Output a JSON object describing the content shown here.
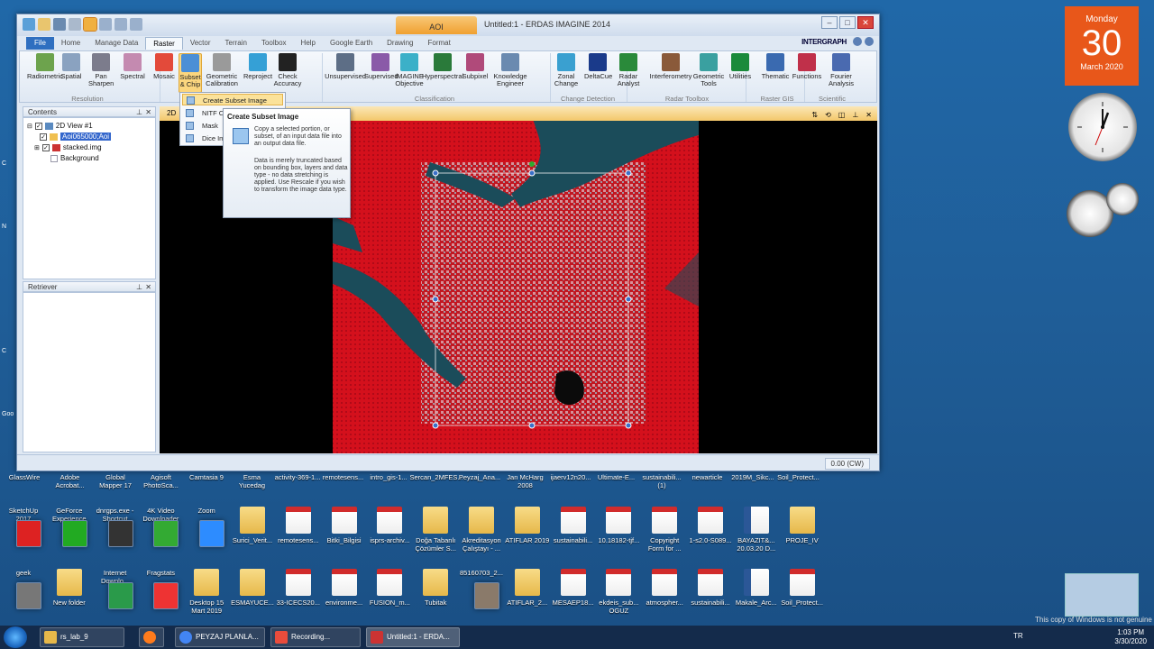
{
  "app": {
    "title": "Untitled:1 - ERDAS IMAGINE 2014",
    "contextual_tab": "AOI",
    "brand": "INTERGRAPH",
    "tabs": [
      "File",
      "Home",
      "Manage Data",
      "Raster",
      "Vector",
      "Terrain",
      "Toolbox",
      "Help",
      "Google Earth",
      "Drawing",
      "Format"
    ],
    "active_tab": "Raster",
    "ribbon": {
      "buttons": [
        {
          "label": "Radiometric",
          "color": "#6da34d"
        },
        {
          "label": "Spatial",
          "color": "#8aa2c0"
        },
        {
          "label": "Pan\nSharpen",
          "color": "#7c7c8c"
        },
        {
          "label": "Spectral",
          "color": "#c48ab0"
        },
        {
          "label": "Mosaic",
          "color": "#e34a3a"
        },
        {
          "label": "Subset\n& Chip",
          "color": "#4b8fd6"
        },
        {
          "label": "Geometric\nCalibration",
          "color": "#9a9a9a"
        },
        {
          "label": "Reproject",
          "color": "#35a0d6"
        },
        {
          "label": "Check\nAccuracy",
          "color": "#222222"
        },
        {
          "label": "Unsupervised",
          "color": "#5d6e86"
        },
        {
          "label": "Supervised",
          "color": "#8a5aa8"
        },
        {
          "label": "IMAGINE\nObjective",
          "color": "#3bb0c8"
        },
        {
          "label": "Hyperspectral",
          "color": "#2a7a3a"
        },
        {
          "label": "Subpixel",
          "color": "#b04a7a"
        },
        {
          "label": "Knowledge\nEngineer",
          "color": "#6a8ab0"
        },
        {
          "label": "Zonal\nChange",
          "color": "#3aa0d0"
        },
        {
          "label": "DeltaCue",
          "color": "#1a3a8a"
        },
        {
          "label": "Radar\nAnalyst",
          "color": "#2a8a3a"
        },
        {
          "label": "Interferometry",
          "color": "#8a5a3a"
        },
        {
          "label": "Geometric\nTools",
          "color": "#3aa0a0"
        },
        {
          "label": "Utilities",
          "color": "#1a8a3a"
        },
        {
          "label": "Thematic",
          "color": "#3a6ab0"
        },
        {
          "label": "Functions",
          "color": "#c0304a"
        },
        {
          "label": "Fourier\nAnalysis",
          "color": "#4a6ab0"
        }
      ],
      "groups": [
        "Resolution",
        "Classification",
        "Change Detection",
        "Radar Toolbox",
        "Raster GIS",
        "Scientific"
      ]
    },
    "contents_panel": {
      "title": "Contents",
      "items": [
        {
          "label": "2D View #1",
          "checked": true
        },
        {
          "label": "Aoi065000;Aoi",
          "checked": true
        },
        {
          "label": "stacked.img",
          "checked": true
        },
        {
          "label": "Background",
          "checked": false
        }
      ]
    },
    "retriever_panel": {
      "title": "Retriever"
    },
    "view": {
      "title_prefix": "2D"
    },
    "status": {
      "coord": "0.00 (CW)"
    },
    "subset_menu": {
      "items": [
        "Create Subset Image",
        "NITF C...",
        "Mask",
        "Dice Im..."
      ],
      "selected": "Create Subset Image"
    },
    "tooltip": {
      "title": "Create Subset Image",
      "p1": "Copy a selected portion, or subset, of an input data file into an output data file.",
      "p2": "Data is merely truncated based on bounding box, layers and data type - no data stretching is applied. Use Rescale if you wish to transform the image data type."
    }
  },
  "clock_tile": {
    "dow": "Monday",
    "day": "30",
    "month_year": "March 2020"
  },
  "desktop": {
    "top_labels": [
      "GlassWire",
      "Adobe\nAcrobat...",
      "Global\nMapper 17",
      "Agisoft\nPhotoSca...",
      "Camtasia 9",
      "Esma\nYucedag",
      "activity-369-1...",
      "remotesens...",
      "intro_gis-1...",
      "Sercan_2MFES...",
      "Peyzaj_Ana...",
      "Jan McHarg\n2008",
      "ijaerv12n20...",
      "Ultimate-E...",
      "sustainabili...\n(1)",
      "newarticle",
      "2019M_Sikc...",
      "Soil_Protect..."
    ],
    "row1": [
      {
        "label": "SketchUp\n2017",
        "type": "app",
        "color": "#d22"
      },
      {
        "label": "GeForce\nExperience",
        "type": "app",
        "color": "#2a2"
      },
      {
        "label": "dnrgps.exe -\nShortcut",
        "type": "app",
        "color": "#333"
      },
      {
        "label": "4K Video\nDownloader",
        "type": "app",
        "color": "#3a3"
      },
      {
        "label": "Zoom",
        "type": "app",
        "color": "#2d8cff"
      },
      {
        "label": "Surici_Verit...",
        "type": "folder"
      },
      {
        "label": "remotesens...",
        "type": "pdf"
      },
      {
        "label": "Bitki_Bilgisi",
        "type": "pdf"
      },
      {
        "label": "isprs-archiv...",
        "type": "pdf"
      },
      {
        "label": "Doğa Tabanlı\nÇözümler S...",
        "type": "folder"
      },
      {
        "label": "Akreditasyon\nÇalıştayı - ...",
        "type": "folder"
      },
      {
        "label": "ATIFLAR 2019",
        "type": "folder"
      },
      {
        "label": "sustainabili...",
        "type": "pdf"
      },
      {
        "label": "10.18182-tjf...",
        "type": "pdf"
      },
      {
        "label": "Copyright\nForm for ...",
        "type": "pdf"
      },
      {
        "label": "1-s2.0-S089...",
        "type": "pdf"
      },
      {
        "label": "BAYAZIT&...\n20.03.20 D...",
        "type": "word"
      },
      {
        "label": "PROJE_IV",
        "type": "folder"
      }
    ],
    "row2": [
      {
        "label": "geek",
        "type": "app",
        "color": "#777"
      },
      {
        "label": "New folder",
        "type": "folder"
      },
      {
        "label": "Internet\nDownlo...",
        "type": "app",
        "color": "#2a9a4a"
      },
      {
        "label": "Fragstats",
        "type": "app",
        "color": "#e33"
      },
      {
        "label": "Desktop 15\nMart 2019",
        "type": "folder"
      },
      {
        "label": "ESMAYUCE...",
        "type": "folder"
      },
      {
        "label": "33-ICECS20...",
        "type": "pdf"
      },
      {
        "label": "environme...",
        "type": "pdf"
      },
      {
        "label": "FUSION_m...",
        "type": "pdf"
      },
      {
        "label": "Tubitak",
        "type": "folder"
      },
      {
        "label": "85160703_2...",
        "type": "app",
        "color": "#8a7a6a"
      },
      {
        "label": "ATIFLAR_2...",
        "type": "folder"
      },
      {
        "label": "MESAEP18...",
        "type": "pdf"
      },
      {
        "label": "ekdeis_sub...\nOGUZ",
        "type": "pdf"
      },
      {
        "label": "atmospher...",
        "type": "pdf"
      },
      {
        "label": "sustainabili...",
        "type": "pdf"
      },
      {
        "label": "Makale_Arc...",
        "type": "word"
      },
      {
        "label": "Soil_Protect...",
        "type": "pdf"
      }
    ],
    "left_fragments": [
      "C",
      "N",
      "C",
      "Goo"
    ]
  },
  "taskbar": {
    "items": [
      {
        "label": "rs_lab_9",
        "color": "#e6b84a"
      },
      {
        "label": "",
        "color": "#ff7b1c"
      },
      {
        "label": "PEYZAJ PLANLA...",
        "color": "#4285f4"
      },
      {
        "label": "Recording...",
        "color": "#e94c3c"
      },
      {
        "label": "Untitled:1 - ERDA...",
        "color": "#c33"
      }
    ],
    "lang": "TR",
    "time": "1:03 PM",
    "date": "3/30/2020",
    "activation": "This copy of Windows is not genuine"
  }
}
